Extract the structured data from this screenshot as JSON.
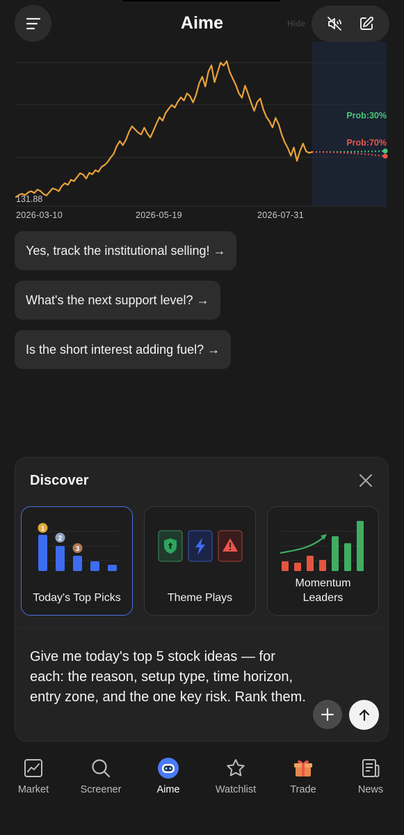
{
  "header": {
    "title": "Aime",
    "ghost_text": "Hide"
  },
  "chart_data": {
    "type": "line",
    "x_ticks": [
      "2026-03-10",
      "2026-05-19",
      "2026-07-31"
    ],
    "y_min_label": "131.88",
    "forecast": {
      "up_label": "Prob:30%",
      "down_label": "Prob:70%",
      "up_color": "#47c87a",
      "down_color": "#e8554a"
    },
    "line_color": "#e9a23b",
    "series": [
      {
        "values": [
          131.9,
          132.8,
          133.3,
          132.7,
          133.9,
          134.4,
          133.6,
          135.1,
          134.5,
          133.2,
          132.6,
          134.1,
          135.6,
          135.2,
          134.4,
          136.6,
          137.8,
          137.1,
          139.3,
          138.7,
          140.4,
          142.1,
          141.5,
          139.8,
          142.3,
          141.6,
          143.4,
          142.7,
          144.8,
          145.6,
          146.9,
          148.8,
          150.4,
          153.7,
          155.9,
          154.1,
          156.4,
          159.8,
          162.2,
          160.8,
          159.5,
          158.7,
          161.6,
          159.1,
          157.4,
          160.3,
          163.4,
          166.1,
          164.6,
          167.9,
          169.7,
          171.3,
          170.2,
          172.8,
          174.6,
          173.2,
          176.3,
          175.1,
          172.4,
          175.8,
          180.7,
          183.4,
          179.2,
          185.6,
          188.3,
          181.1,
          185.3,
          189.4,
          188.2,
          190.1,
          185.4,
          182.6,
          179.8,
          176.3,
          174.4,
          179.6,
          176.1,
          172.2,
          168.8,
          172.6,
          174.1,
          169.4,
          166.2,
          164.3,
          161.7,
          165.8,
          163.1,
          158.7,
          155.3,
          152.9,
          149.6,
          153.1,
          147.4,
          151.6,
          154.8,
          151.5,
          150.8,
          151.2
        ]
      }
    ],
    "forecast_start": 151.2,
    "forecast_up_end": 151.6,
    "forecast_down_end": 149.4,
    "ylim": [
      128,
      196
    ]
  },
  "suggestions": [
    "Yes, track the institutional selling! →",
    "What's the next support level? →",
    "Is the short interest adding fuel? →"
  ],
  "discover": {
    "title": "Discover",
    "cards": [
      {
        "label": "Today's Top Picks",
        "selected": true
      },
      {
        "label": "Theme Plays",
        "selected": false
      },
      {
        "label": "Momentum Leaders",
        "selected": false
      }
    ],
    "rank_badges": [
      "1",
      "2",
      "3"
    ],
    "prompt": "Give me today's top 5 stock ideas — for each: the reason, setup type, time horizon, entry zone, and the one key risk. Rank them."
  },
  "tabbar": {
    "items": [
      {
        "label": "Market",
        "icon": "market-chart-icon"
      },
      {
        "label": "Screener",
        "icon": "search-icon"
      },
      {
        "label": "Aime",
        "icon": "robot-icon"
      },
      {
        "label": "Watchlist",
        "icon": "star-icon"
      },
      {
        "label": "Trade",
        "icon": "gift-icon"
      },
      {
        "label": "News",
        "icon": "newspaper-icon"
      }
    ]
  }
}
